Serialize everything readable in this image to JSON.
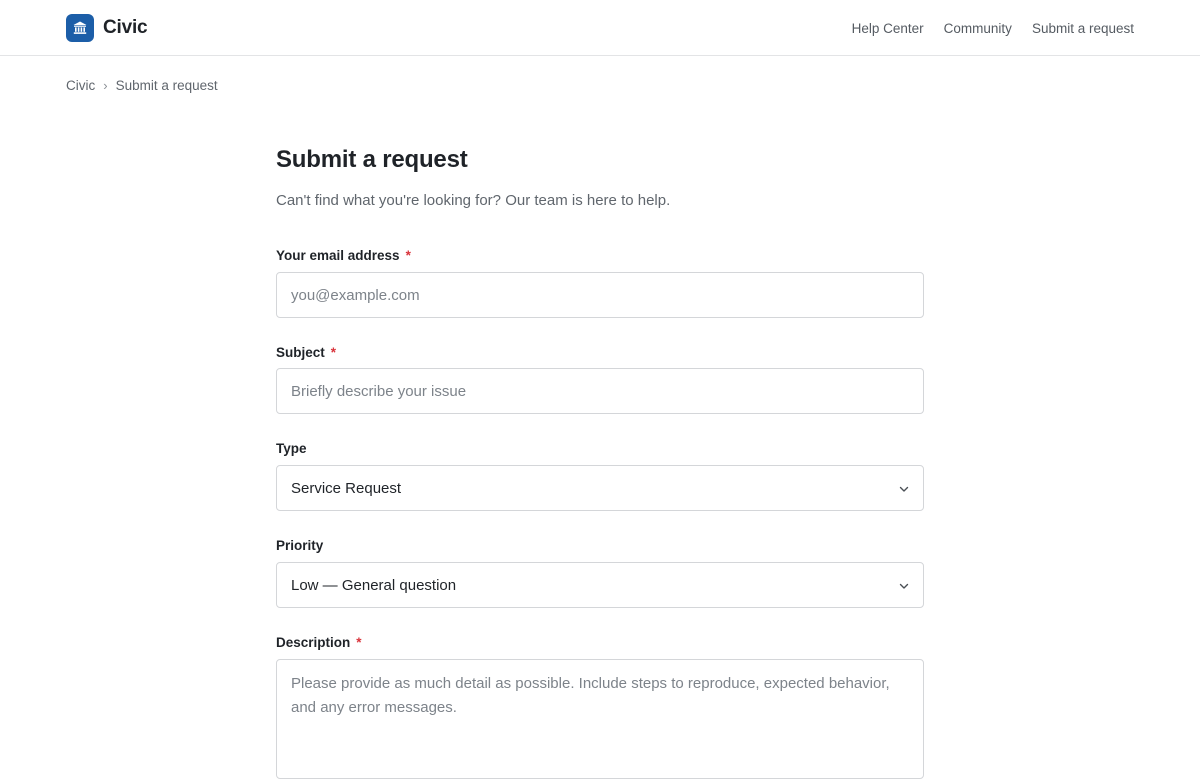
{
  "header": {
    "brand_name": "Civic",
    "logo_icon": "bank-icon",
    "brand_color": "#1c5ea8",
    "nav": [
      {
        "label": "Help Center"
      },
      {
        "label": "Community"
      },
      {
        "label": "Submit a request"
      }
    ]
  },
  "breadcrumb": {
    "items": [
      "Civic",
      "Submit a request"
    ],
    "separator": "›"
  },
  "form": {
    "title": "Submit a request",
    "subtitle": "Can't find what you're looking for? Our team is here to help.",
    "required_marker": "*",
    "email": {
      "label": "Your email address",
      "placeholder": "you@example.com",
      "value": ""
    },
    "subject": {
      "label": "Subject",
      "placeholder": "Briefly describe your issue",
      "value": ""
    },
    "type": {
      "label": "Type",
      "selected": "Service Request"
    },
    "priority": {
      "label": "Priority",
      "selected": "Low — General question"
    },
    "description": {
      "label": "Description",
      "placeholder": "Please provide as much detail as possible. Include steps to reproduce, expected behavior, and any error messages.",
      "value": ""
    }
  }
}
